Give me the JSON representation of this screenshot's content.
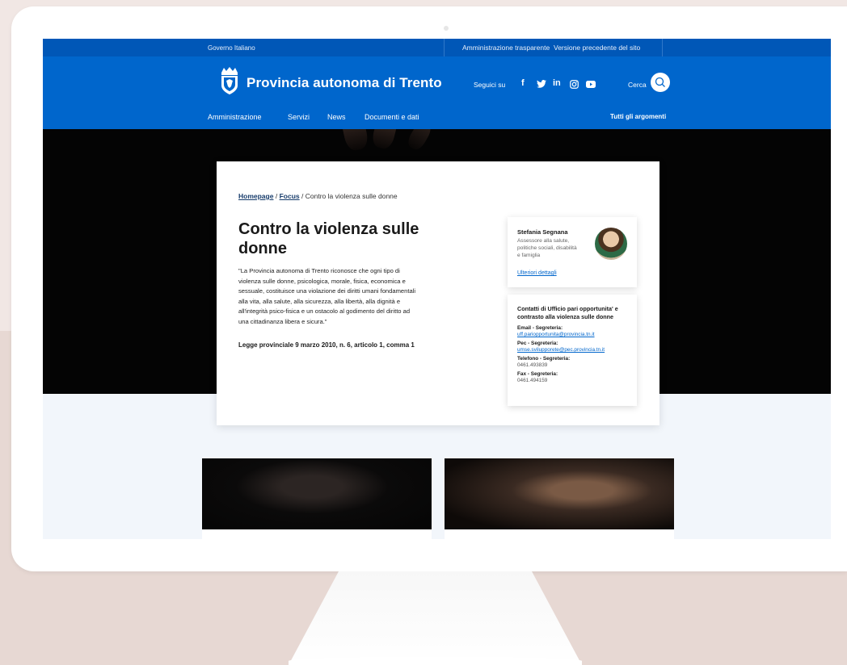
{
  "topbar": {
    "governo": "Governo Italiano",
    "amministrazione_trasparente": "Amministrazione trasparente",
    "versione_precedente": "Versione precedente del sito"
  },
  "header": {
    "site_title": "Provincia autonoma di Trento",
    "seguici": "Seguici su",
    "social": [
      {
        "icon": "facebook-icon",
        "glyph": "f"
      },
      {
        "icon": "twitter-icon",
        "glyph": "🐦"
      },
      {
        "icon": "linkedin-icon",
        "glyph": "in"
      },
      {
        "icon": "instagram-icon",
        "glyph": "◎"
      },
      {
        "icon": "youtube-icon",
        "glyph": "▶"
      }
    ],
    "cerca": "Cerca"
  },
  "nav": {
    "items": [
      "Amministrazione",
      "Servizi",
      "News",
      "Documenti e dati"
    ],
    "tutti": "Tutti gli argomenti"
  },
  "breadcrumb": {
    "home": "Homepage",
    "focus": "Focus",
    "separator": "/",
    "current": "Contro la violenza sulle donne"
  },
  "main": {
    "title": "Contro la violenza sulle donne",
    "quote": "\"La Provincia autonoma di Trento riconosce che ogni tipo di violenza sulle donne, psicologica, morale, fisica, economica e sessuale, costituisce una violazione dei diritti umani fondamentali alla vita, alla salute, alla sicurezza, alla libertà, alla dignità e all'integrità psico-fisica e un ostacolo al godimento del diritto ad una cittadinanza libera e sicura.\"",
    "law": "Legge provinciale 9 marzo 2010, n. 6, articolo 1, comma 1"
  },
  "person": {
    "name": "Stefania Segnana",
    "role": "Assessore alla salute, politiche sociali, disabilità e famiglia",
    "link": "Ulteriori dettagli"
  },
  "contact": {
    "title": "Contatti di Ufficio pari opportunita' e contrasto alla violenza sulle donne",
    "email_label": "Email - Segreteria:",
    "email": "uff.pariopportunita@provincia.tn.it",
    "pec_label": "Pec - Segreteria:",
    "pec": "umse.svilupporete@pec.provincia.tn.it",
    "tel_label": "Telefono - Segreteria:",
    "tel": "0461.493839",
    "fax_label": "Fax - Segreteria:",
    "fax": "0461.494159"
  },
  "colors": {
    "brand_blue": "#0066cc",
    "topbar_blue": "#0057b7"
  }
}
